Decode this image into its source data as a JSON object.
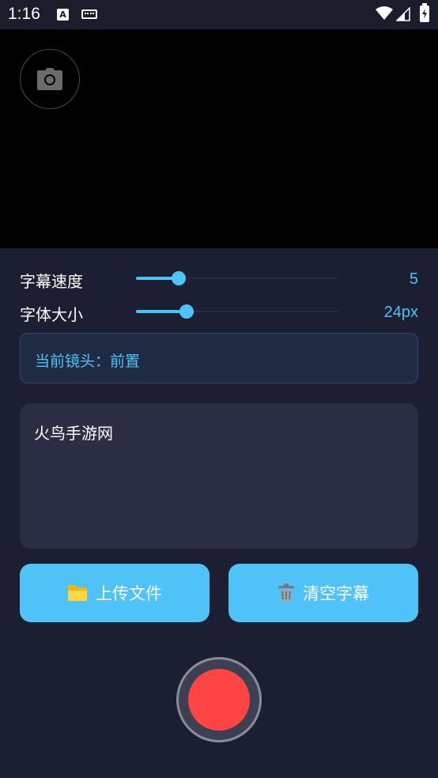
{
  "status_bar": {
    "time": "1:16",
    "notification_a": "A",
    "icons": [
      "a-notification-icon",
      "keyboard-icon",
      "wifi-icon",
      "signal-icon",
      "battery-charging-icon"
    ]
  },
  "camera": {
    "switch_icon": "camera-icon"
  },
  "settings": {
    "speed": {
      "label": "字幕速度",
      "value": "5",
      "level": 0.21
    },
    "font_size": {
      "label": "字体大小",
      "value": "24px",
      "level": 0.25
    }
  },
  "lens_status": "当前镜头：前置",
  "subtitle_text": "火鸟手游网",
  "buttons": {
    "upload": {
      "icon": "folder-icon",
      "label": "上传文件"
    },
    "clear": {
      "icon": "trash-icon",
      "label": "清空字幕"
    }
  },
  "record_button": {
    "icon": "record-icon"
  },
  "colors": {
    "accent": "#4fc3f7",
    "background": "#1c1e31",
    "panel": "#2b2d42",
    "record": "#ff4444"
  }
}
